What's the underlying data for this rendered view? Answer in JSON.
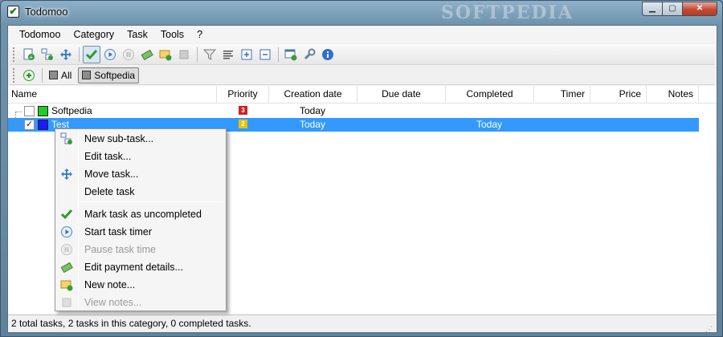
{
  "window": {
    "title": "Todomoo",
    "watermark": "SOFTPEDIA"
  },
  "menubar": {
    "items": [
      "Todomoo",
      "Category",
      "Task",
      "Tools",
      "?"
    ]
  },
  "toolbar": {
    "buttons": [
      "new-task-icon",
      "new-subtask-icon",
      "move-task-icon",
      "mark-completed-icon",
      "start-timer-icon",
      "pause-timer-icon",
      "payment-icon",
      "new-note-icon",
      "view-notes-icon",
      "filter-icon",
      "sort-icon",
      "expand-all-icon",
      "collapse-all-icon",
      "add-category-icon",
      "settings-icon",
      "info-icon"
    ]
  },
  "categories": {
    "all_label": "All",
    "softpedia_label": "Softpedia"
  },
  "columns": [
    "Name",
    "Priority",
    "Creation date",
    "Due date",
    "Completed",
    "Timer",
    "Price",
    "Notes"
  ],
  "tasks": [
    {
      "name": "Softpedia",
      "checked": false,
      "color": "#22cc22",
      "priority": "3",
      "priority_color": "#cc2222",
      "created": "Today",
      "due": "",
      "completed": "",
      "selected": false
    },
    {
      "name": "Test",
      "checked": true,
      "color": "#1a1aff",
      "priority": "2",
      "priority_color": "#e6c200",
      "created": "Today",
      "due": "",
      "completed": "Today",
      "selected": true
    }
  ],
  "context_menu": {
    "new_subtask": "New sub-task...",
    "edit_task": "Edit task...",
    "move_task": "Move task...",
    "delete_task": "Delete task",
    "mark_uncompleted": "Mark task as uncompleted",
    "start_timer": "Start task timer",
    "pause_timer": "Pause task time",
    "edit_payment": "Edit payment details...",
    "new_note": "New note...",
    "view_notes": "View notes..."
  },
  "status": {
    "text": "2 total tasks, 2 tasks in this category, 0 completed tasks."
  }
}
